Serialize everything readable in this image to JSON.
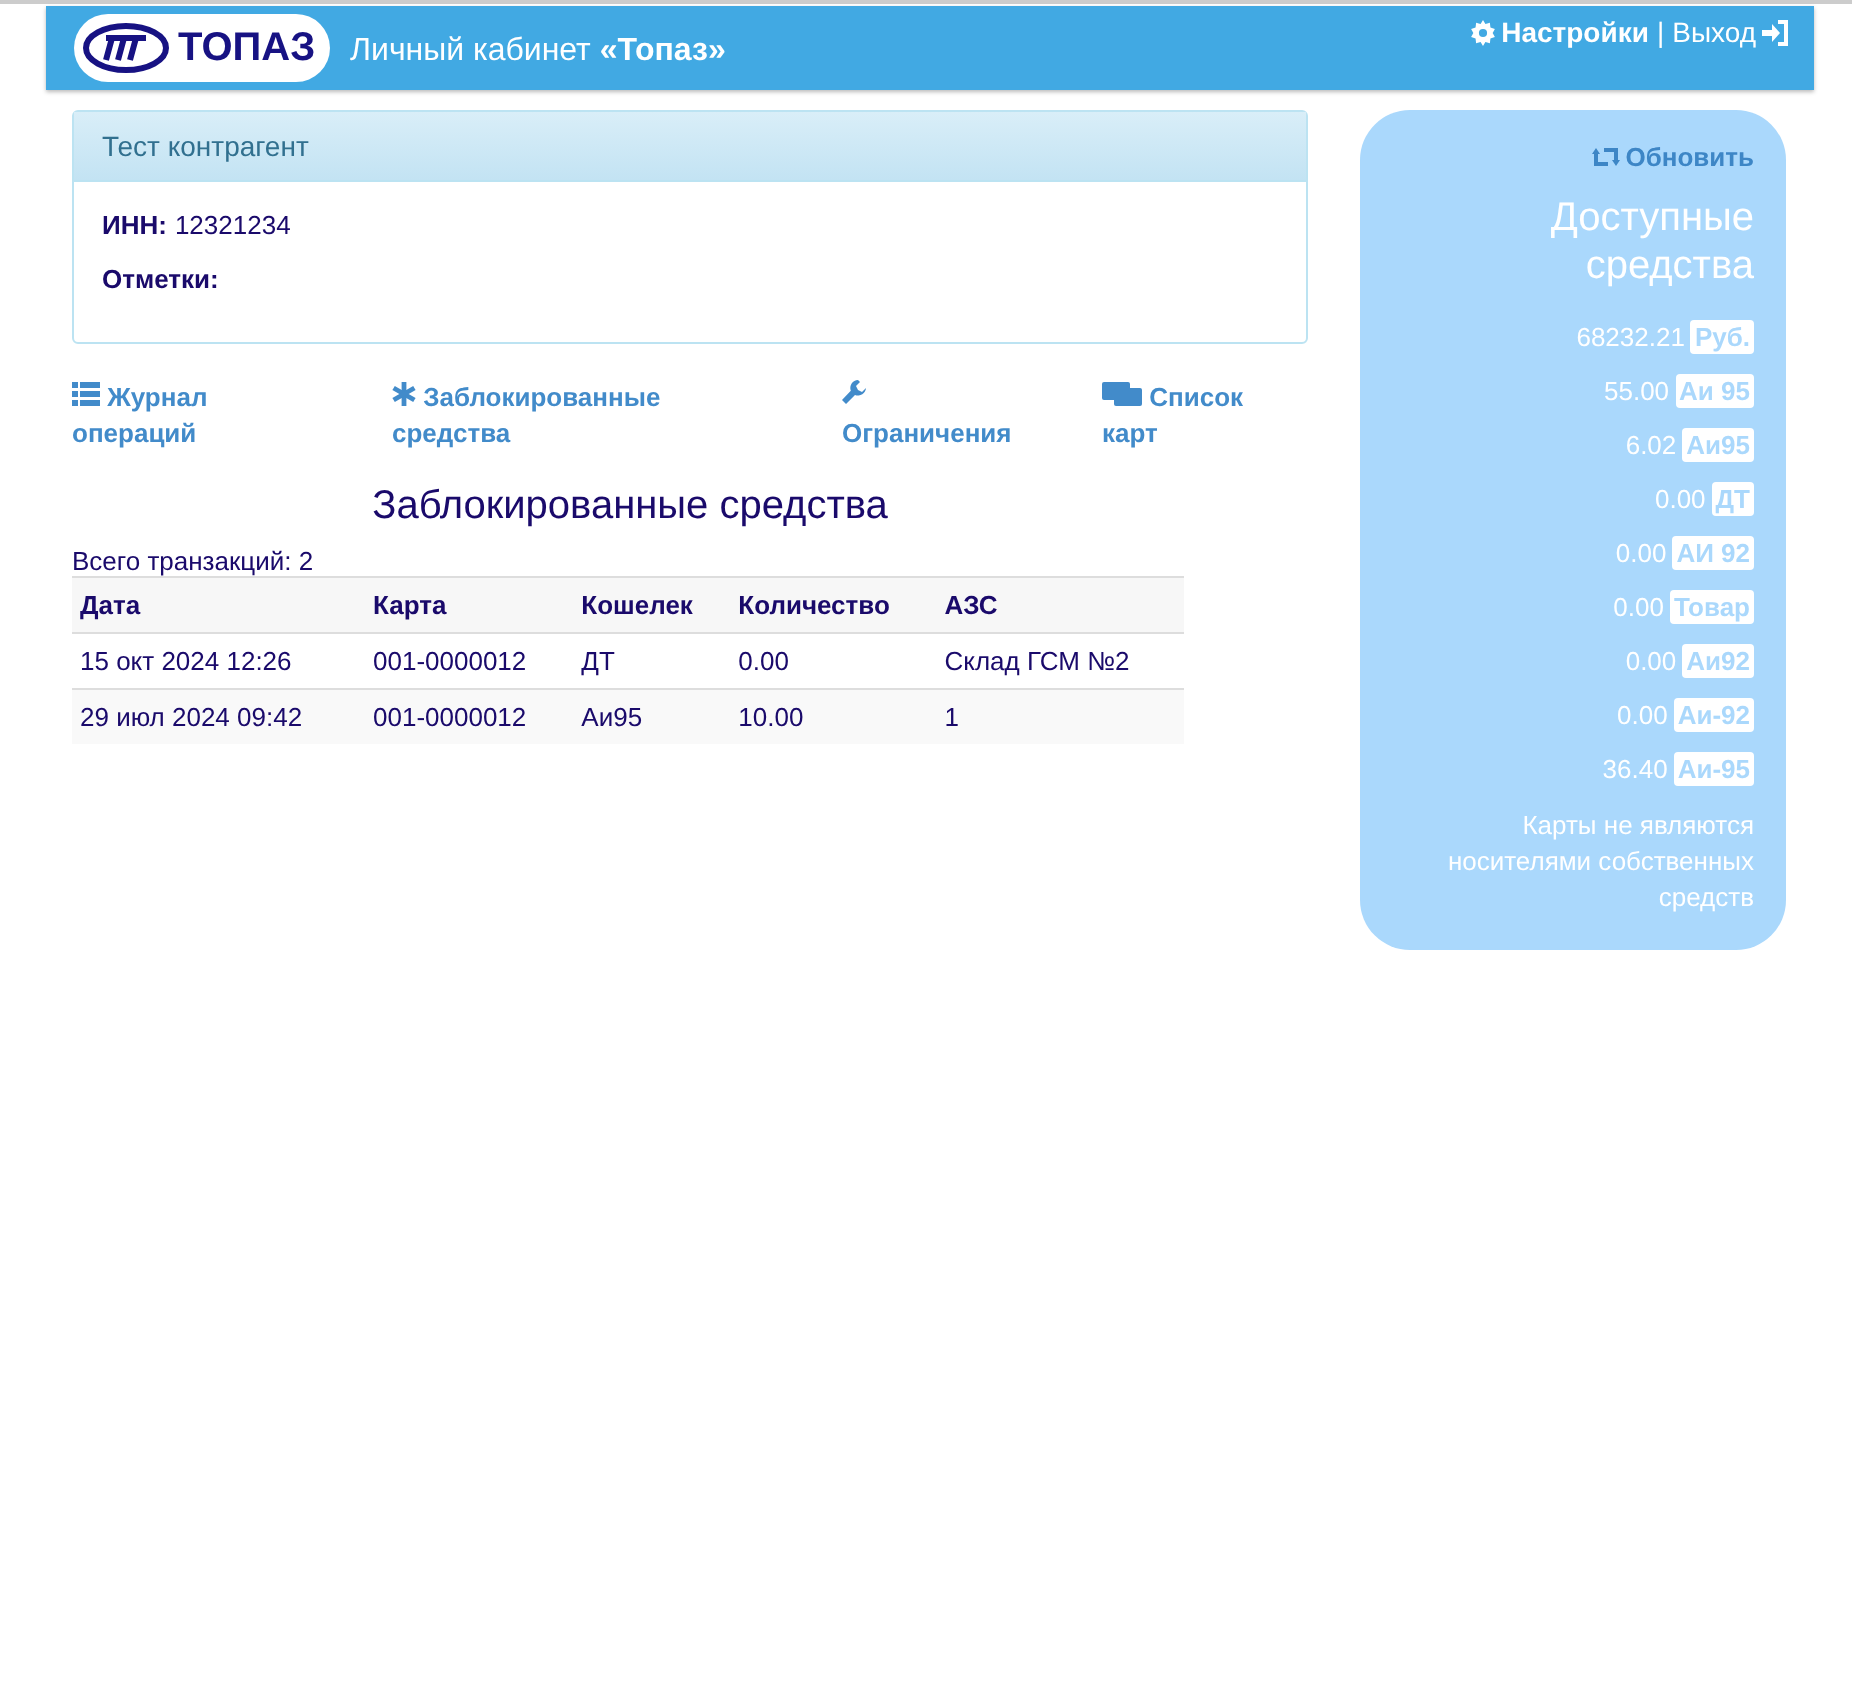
{
  "header": {
    "logo_text": "ТОПАЗ",
    "title": "Личный кабинет **«Топаз»**",
    "settings": "Настройки",
    "separator": "|",
    "logout": "Выход"
  },
  "account": {
    "name": "Тест контрагент",
    "fields": [
      {
        "label": "ИНН:",
        "value": "12321234"
      },
      {
        "label": "Отметки:"
      }
    ]
  },
  "nav": [
    {
      "label": "Журнал операций"
    },
    {
      "label": "Заблокированные средства"
    },
    {
      "label": "Ограничения"
    },
    {
      "label": "Список карт"
    }
  ],
  "page_title": "Заблокированные средства",
  "total": "Всего транзакций: 2",
  "table": {
    "columns": [
      "Дата",
      "Карта",
      "Кошелек",
      "Количество",
      "АЗС"
    ],
    "rows": [
      [
        "15 окт 2024 12:26",
        "001-0000012",
        "ДТ",
        "0.00",
        "Склад ГСМ №2"
      ],
      [
        "29 июл 2024 09:42",
        "001-0000012",
        "Аи95",
        "10.00",
        "1"
      ]
    ]
  },
  "funds": {
    "refresh": "Обновить",
    "title": "Доступные средства",
    "items": [
      {
        "amount": "68232.21",
        "unit": "Руб."
      },
      {
        "amount": "55.00",
        "unit": "Аи 95"
      },
      {
        "amount": "6.02",
        "unit": "Аи95"
      },
      {
        "amount": "0.00",
        "unit": "ДТ"
      },
      {
        "amount": "0.00",
        "unit": "АИ 92"
      },
      {
        "amount": "0.00",
        "unit": "Товар"
      },
      {
        "amount": "0.00",
        "unit": "Аи92"
      },
      {
        "amount": "0.00",
        "unit": "Аи-92"
      },
      {
        "amount": "36.40",
        "unit": "Аи-95"
      }
    ],
    "note": "Карты не являются носителями собственных средств"
  }
}
